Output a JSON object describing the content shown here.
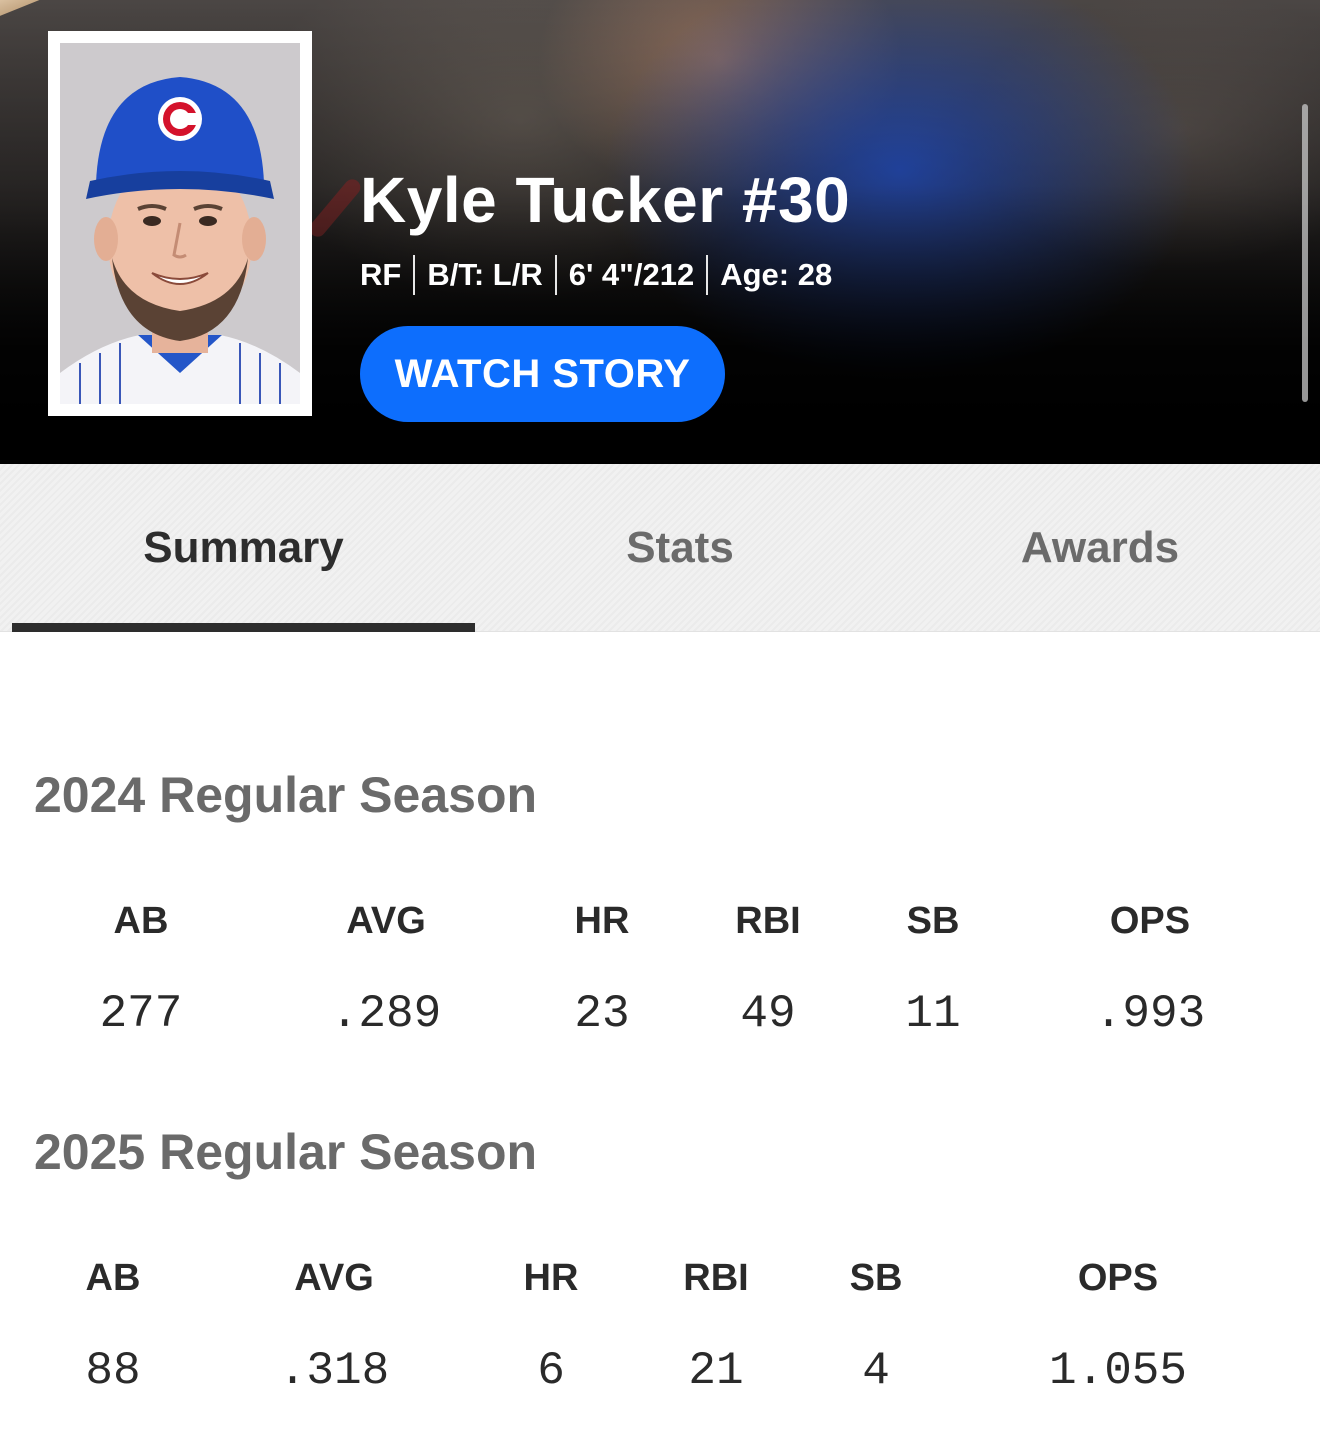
{
  "player": {
    "name": "Kyle Tucker #30",
    "position": "RF",
    "bats_throws": "B/T: L/R",
    "height_weight": "6' 4\"/212",
    "age": "Age: 28"
  },
  "hero": {
    "watch_label": "WATCH STORY",
    "colors": {
      "button": "#0d6efd"
    },
    "icons": {
      "cap_logo": "cubs-c-logo-icon"
    }
  },
  "tabs": [
    {
      "label": "Summary",
      "active": true
    },
    {
      "label": "Stats",
      "active": false
    },
    {
      "label": "Awards",
      "active": false
    }
  ],
  "seasons": [
    {
      "title": "2024 Regular Season",
      "stats": [
        {
          "label": "AB",
          "value": "277"
        },
        {
          "label": "AVG",
          "value": ".289"
        },
        {
          "label": "HR",
          "value": "23"
        },
        {
          "label": "RBI",
          "value": "49"
        },
        {
          "label": "SB",
          "value": "11"
        },
        {
          "label": "OPS",
          "value": ".993"
        }
      ]
    },
    {
      "title": "2025 Regular Season",
      "stats": [
        {
          "label": "AB",
          "value": "88"
        },
        {
          "label": "AVG",
          "value": ".318"
        },
        {
          "label": "HR",
          "value": "6"
        },
        {
          "label": "RBI",
          "value": "21"
        },
        {
          "label": "SB",
          "value": "4"
        },
        {
          "label": "OPS",
          "value": "1.055"
        }
      ]
    }
  ]
}
